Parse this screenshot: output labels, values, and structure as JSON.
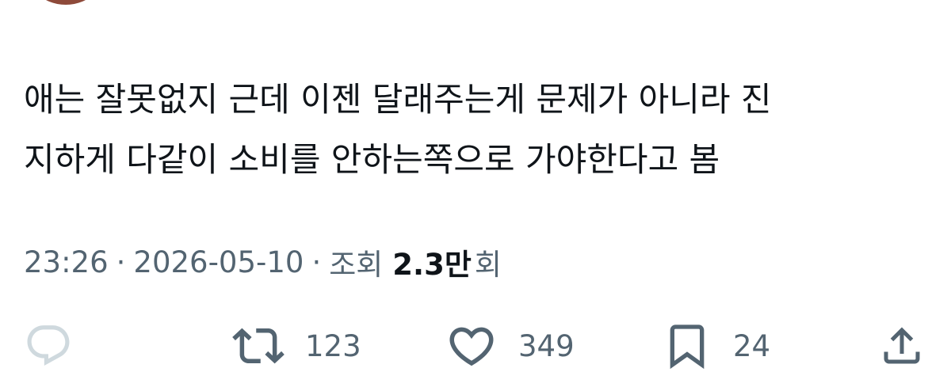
{
  "tweet": {
    "text_line1": "애는 잘못없지 근데 이젠 달래주는게 문제가 아니라 진",
    "text_line2": "지하게 다같이 소비를 안하는쪽으로 가야한다고 봄"
  },
  "meta": {
    "time": "23:26",
    "separator": "·",
    "date": "2026-05-10",
    "views_label": "조회",
    "views_count": "2.3만",
    "views_suffix": "회"
  },
  "actions": {
    "reply": {
      "icon": "reply-icon",
      "count": ""
    },
    "retweet": {
      "icon": "retweet-icon",
      "count": "123"
    },
    "like": {
      "icon": "heart-icon",
      "count": "349"
    },
    "bookmark": {
      "icon": "bookmark-icon",
      "count": "24"
    },
    "share": {
      "icon": "share-icon"
    }
  },
  "colors": {
    "text": "#0f1419",
    "secondary": "#536471",
    "reply_icon_faded": "#cfd9de",
    "avatar": "#8e4a3a"
  }
}
